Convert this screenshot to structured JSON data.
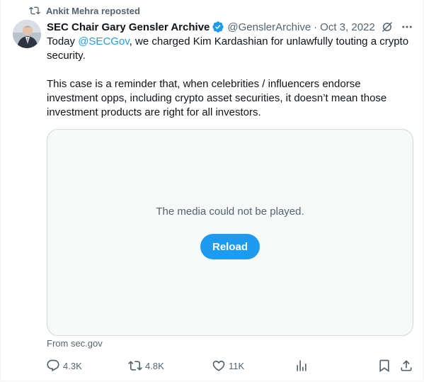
{
  "repost": {
    "icon": "repost-icon",
    "text": "Ankit Mehra reposted"
  },
  "author": {
    "display_name": "SEC Chair Gary Gensler Archive",
    "verified_icon": "verified-badge-icon",
    "handle": "@GenslerArchive",
    "separator": "·",
    "date": "Oct 3, 2022"
  },
  "body": {
    "p1_before": "Today ",
    "p1_mention": "@SECGov",
    "p1_after": ", we charged Kim Kardashian for unlawfully touting a crypto security.",
    "p2": "This case is a reminder that, when celebrities / influencers endorse investment opps, including crypto asset securities, it doesn’t mean those investment products are right for all investors."
  },
  "media": {
    "message": "The media could not be played.",
    "reload_label": "Reload"
  },
  "source": "From sec.gov",
  "actions": {
    "replies": "4.3K",
    "reposts": "4.8K",
    "likes": "11K"
  },
  "colors": {
    "accent": "#1d9bf0",
    "secondary_text": "#536471",
    "primary_text": "#0f1419",
    "border": "#cfd9de"
  }
}
